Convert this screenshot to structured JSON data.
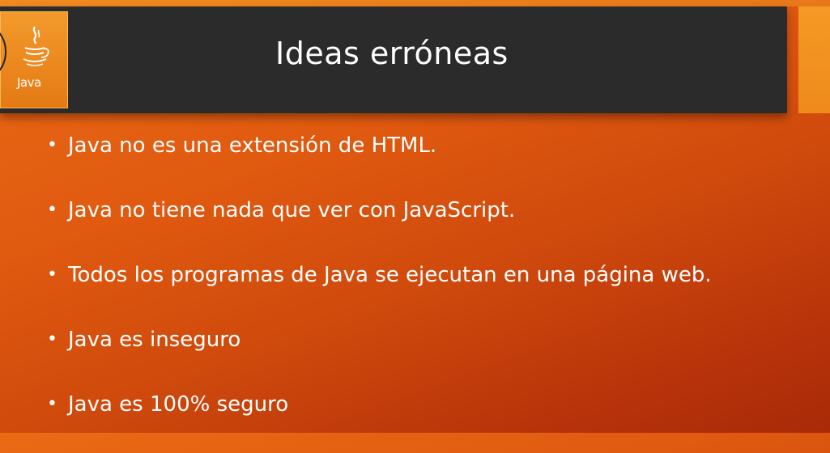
{
  "slide": {
    "title": "Ideas erróneas",
    "logo": {
      "icon": "java-coffee-cup-icon",
      "text": "Java"
    },
    "bullets": [
      "Java no es una extensión de HTML.",
      "Java no tiene nada que ver con JavaScript.",
      "Todos los programas de Java se ejecutan en una página web.",
      "Java es inseguro",
      "Java es 100% seguro"
    ],
    "bullet_symbol": "•"
  },
  "colors": {
    "title_bar": "#2b2b2b",
    "background_start": "#ea6a14",
    "background_end": "#a82a08",
    "accent": "#f59a24",
    "text": "#ffffff"
  }
}
